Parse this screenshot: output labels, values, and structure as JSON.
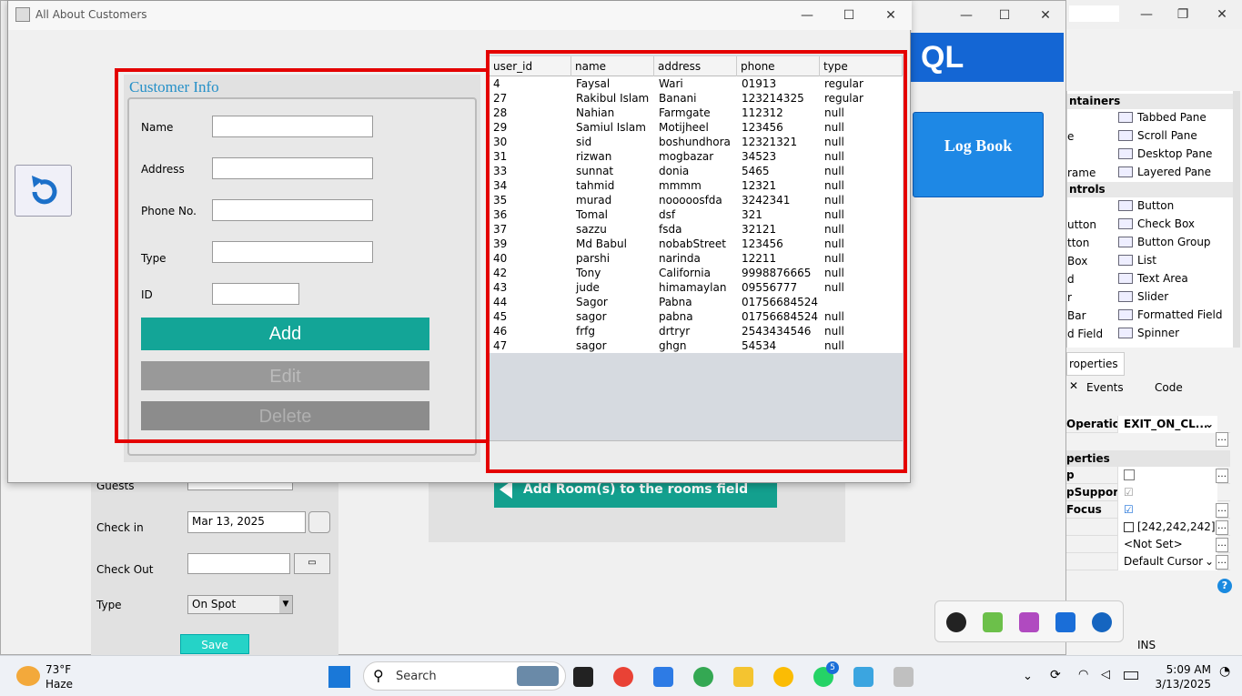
{
  "main_window": {
    "title": "All About Customers"
  },
  "form": {
    "panel_title": "Customer Info",
    "labels": {
      "name": "Name",
      "address": "Address",
      "phone": "Phone No.",
      "type": "Type",
      "id": "ID"
    },
    "buttons": {
      "add": "Add",
      "edit": "Edit",
      "delete": "Delete"
    }
  },
  "table": {
    "columns": [
      "user_id",
      "name",
      "address",
      "phone",
      "type"
    ],
    "rows": [
      [
        "4",
        "Faysal",
        "Wari",
        "01913",
        "regular"
      ],
      [
        "27",
        "Rakibul Islam",
        "Banani",
        "123214325",
        "regular"
      ],
      [
        "28",
        "Nahian",
        "Farmgate",
        "112312",
        "null"
      ],
      [
        "29",
        "Samiul Islam",
        "Motijheel",
        "123456",
        "null"
      ],
      [
        "30",
        "sid",
        "boshundhora",
        "12321321",
        "null"
      ],
      [
        "31",
        "rizwan",
        "mogbazar",
        "34523",
        "null"
      ],
      [
        "33",
        "sunnat",
        "donia",
        "5465",
        "null"
      ],
      [
        "34",
        "tahmid",
        "mmmm",
        "12321",
        "null"
      ],
      [
        "35",
        "murad",
        "nooooosfda",
        "3242341",
        "null"
      ],
      [
        "36",
        "Tomal",
        "dsf",
        "321",
        "null"
      ],
      [
        "37",
        "sazzu",
        "fsda",
        "32121",
        "null"
      ],
      [
        "39",
        "Md Babul",
        "nobabStreet",
        "123456",
        "null"
      ],
      [
        "40",
        "parshi",
        "narinda",
        "12211",
        "null"
      ],
      [
        "42",
        "Tony",
        "California",
        "9998876665",
        "null"
      ],
      [
        "43",
        "jude",
        "himamaylan",
        "09556777",
        "null"
      ],
      [
        "44",
        "Sagor",
        "Pabna",
        "01756684524",
        ""
      ],
      [
        "45",
        "sagor",
        "pabna",
        "01756684524",
        "null"
      ],
      [
        "46",
        "frfg",
        "drtryr",
        "2543434546",
        "null"
      ],
      [
        "47",
        "sagor",
        "ghgn",
        "54534",
        "null"
      ]
    ]
  },
  "background_window": {
    "banner_text": "QL",
    "logbook_label": "Log Book",
    "booking": {
      "guests_label": "Guests",
      "checkin_label": "Check in",
      "checkin_value": "Mar 13, 2025",
      "checkout_label": "Check Out",
      "type_label": "Type",
      "type_value": "On Spot",
      "save_label": "Save"
    },
    "add_rooms_label": "Add Room(s) to the rooms field"
  },
  "ide": {
    "palette": {
      "containers_header": "ntainers",
      "controls_header": "ntrols",
      "left_items": [
        "e",
        "rame",
        "utton",
        "tton",
        "Box",
        "d",
        "r",
        "Bar",
        "d Field"
      ],
      "items": [
        "Tabbed Pane",
        "Scroll Pane",
        "Desktop Pane",
        "Layered Pane",
        "Button",
        "Check Box",
        "Button Group",
        "List",
        "Text Area",
        "Slider",
        "Formatted Field",
        "Spinner"
      ]
    },
    "properties": {
      "tab_label": "roperties",
      "tab_events": "Events",
      "tab_code": "Code",
      "close_operation_label": "Operation",
      "close_operation_value": "EXIT_ON_CL...",
      "section_label": "perties",
      "row_labels": [
        "p",
        "pSupporte",
        "Focus"
      ],
      "color_value": "[242,242,242]",
      "not_set": "<Not Set>",
      "cursor_value": "Default Cursor",
      "status": "INS"
    }
  },
  "taskbar": {
    "weather_temp": "73°F",
    "weather_desc": "Haze",
    "search_placeholder": "Search",
    "whatsapp_badge": "5",
    "time": "5:09 AM",
    "date": "3/13/2025"
  }
}
